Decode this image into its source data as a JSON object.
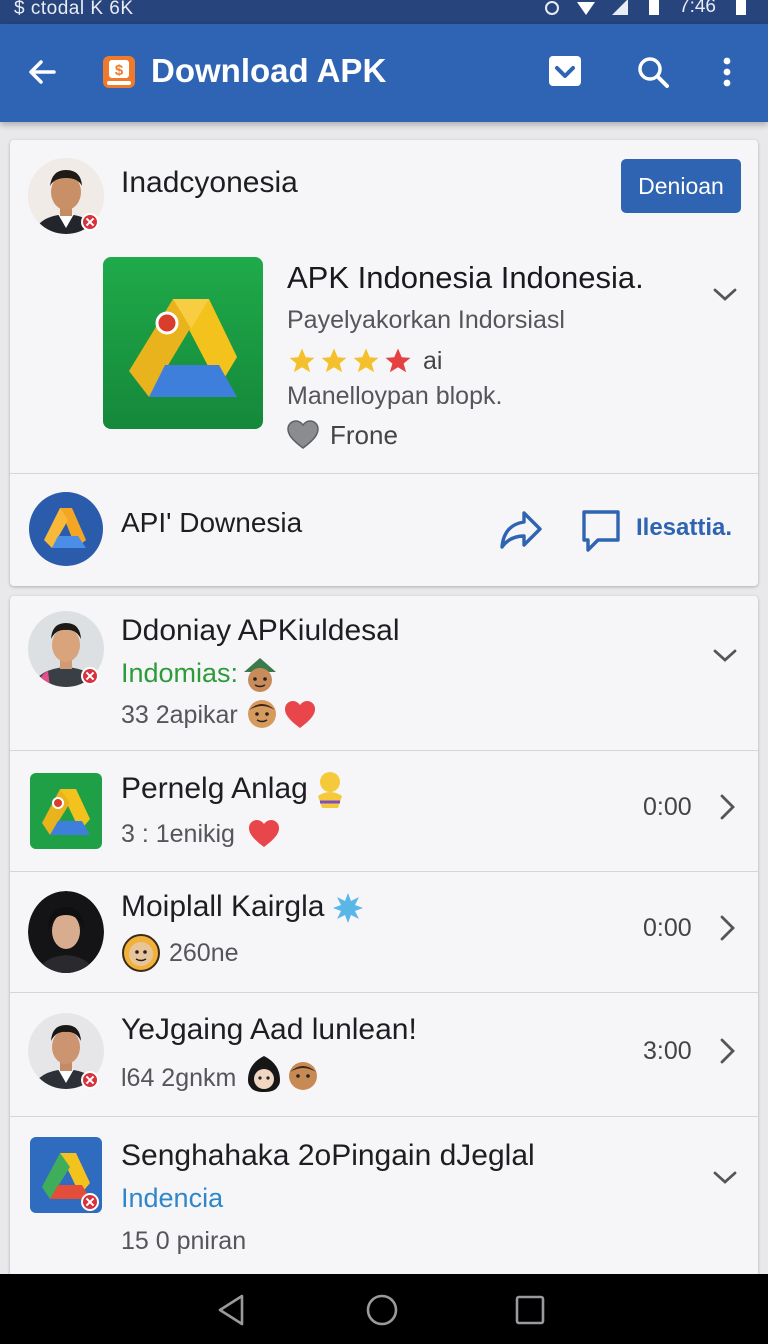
{
  "status_bar": {
    "left_text": "$  ctodal K  6K",
    "time": "7:46"
  },
  "app_bar": {
    "title": "Download APK"
  },
  "featured": {
    "user_name": "Inadcyonesia",
    "action_button": "Denioan",
    "app": {
      "title": "APK Indonesia Indonesia.",
      "subtitle": "Payelyakorkan Indorsiasl",
      "rating_suffix": "ai",
      "developer": "Manelloypan blopk.",
      "price": "Frone"
    },
    "footer": {
      "name": "API' Downesia",
      "share_label": "Ilesattia."
    }
  },
  "list": [
    {
      "title": "Ddoniay APKiuldesal",
      "line2": "Indomias:",
      "line2_style": "green",
      "line3": "33 2apikar",
      "time": "",
      "trailing": "chevron-down"
    },
    {
      "title": "Pernelg Anlag",
      "line2": "3 : 1enikig",
      "line2_style": "sub",
      "line3": "",
      "time": "0:00",
      "trailing": "chevron-right"
    },
    {
      "title": "Moiplall Kairgla",
      "line2": "260ne",
      "line2_style": "sub",
      "line3": "",
      "time": "0:00",
      "trailing": "chevron-right"
    },
    {
      "title": "YeJgaing Aad lunlean!",
      "line2": "l64 2gnkm",
      "line2_style": "sub",
      "line3": "",
      "time": "3:00",
      "trailing": "chevron-right"
    },
    {
      "title": "Senghahaka 2oPingain dJeglal",
      "line2": "Indencia",
      "line2_style": "blue",
      "line3": "15 0 pniran",
      "time": "",
      "trailing": "chevron-down"
    }
  ]
}
